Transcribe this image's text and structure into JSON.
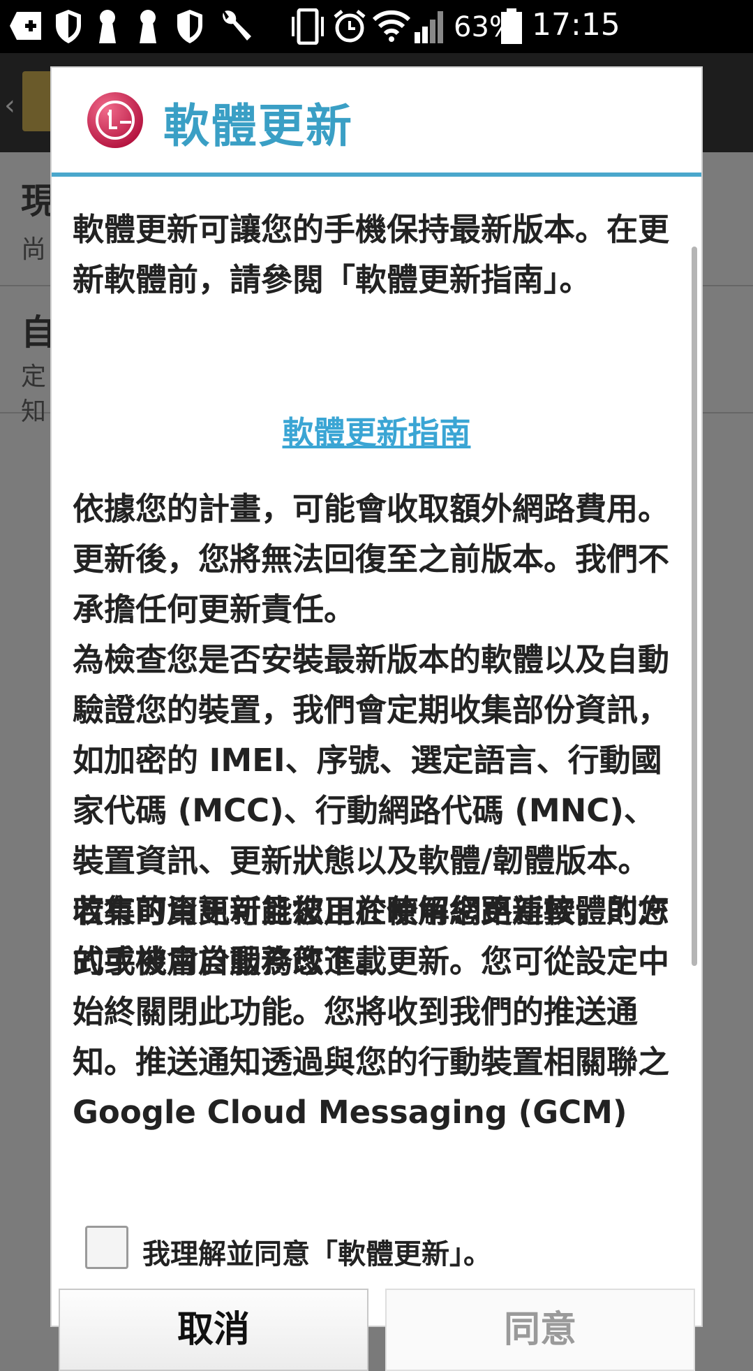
{
  "status_bar": {
    "battery_percent": "63%",
    "time": "17:15",
    "icons": [
      "plus-badge-icon",
      "shield-icon",
      "keyhole-icon",
      "keyhole-icon",
      "shield-icon",
      "wrench-icon",
      "vibrate-icon",
      "alarm-icon",
      "wifi-icon",
      "signal-icon",
      "battery-icon"
    ]
  },
  "background": {
    "row1_title": "現",
    "row1_sub": "尚",
    "row2_title": "自",
    "row2_sub1": "定",
    "row2_sub2": "知"
  },
  "dialog": {
    "title": "軟體更新",
    "intro": "軟體更新可讓您的手機保持最新版本。在更新軟體前，請參閱「軟體更新指南」。",
    "guide_link": "軟體更新指南",
    "body_p1": "依據您的計畫，可能會收取額外網路費用。更新後，您將無法回復至之前版本。我們不承擔任何更新責任。",
    "body_p2": "為檢查您是否安裝最新版本的軟體以及自動驗證您的裝置，我們會定期收集部份資訊，如加密的 IMEI、序號、選定語言、行動國家代碼 (MCC)、行動網路代碼 (MNC)、裝置資訊、更新狀態以及軟體/韌體版本。收集的資訊可能被用於瞭解您更新軟體的方式或被用於服務改進。",
    "body_p3": "若有可用更新且您正在使用網路連接，則您的手機會自動為您下載更新。您可從設定中始終關閉此功能。您將收到我們的推送通知。推送通知透過與您的行動裝置相關聯之 Google Cloud Messaging (GCM)",
    "agree_checkbox_label": "我理解並同意「軟體更新」。",
    "agree_checked": false,
    "cancel_label": "取消",
    "agree_label": "同意"
  }
}
